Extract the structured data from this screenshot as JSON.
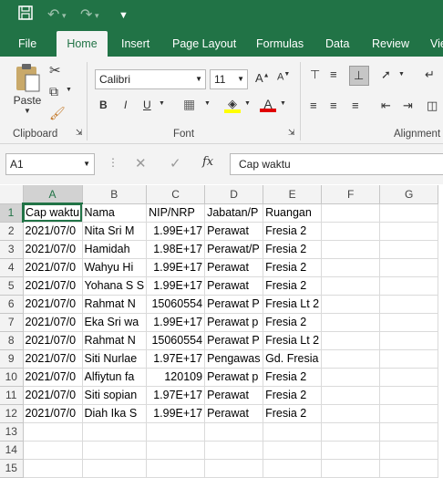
{
  "title_bar": {
    "save": "save-icon",
    "undo": "undo-icon",
    "redo": "redo-icon",
    "customize": "customize-quick-access-icon"
  },
  "tabs": [
    "File",
    "Home",
    "Insert",
    "Page Layout",
    "Formulas",
    "Data",
    "Review",
    "Vie"
  ],
  "active_tab": "Home",
  "clipboard": {
    "paste_label": "Paste",
    "group_label": "Clipboard"
  },
  "font": {
    "name": "Calibri",
    "size": "11",
    "group_label": "Font",
    "bold": "B",
    "italic": "I",
    "underline": "U"
  },
  "alignment": {
    "group_label": "Alignment"
  },
  "name_box": "A1",
  "formula_value": "Cap waktu",
  "fx_label": "fx",
  "columns": [
    "A",
    "B",
    "C",
    "D",
    "E",
    "F",
    "G"
  ],
  "rows": [
    [
      "Cap waktu",
      "Nama",
      "NIP/NRP",
      "Jabatan/P",
      "Ruangan",
      "",
      ""
    ],
    [
      "2021/07/0",
      "Nita Sri M",
      "1.99E+17",
      "Perawat",
      "Fresia 2",
      "",
      ""
    ],
    [
      "2021/07/0",
      "Hamidah",
      "1.98E+17",
      "Perawat/P",
      "Fresia 2",
      "",
      ""
    ],
    [
      "2021/07/0",
      "Wahyu Hi",
      "1.99E+17",
      "Perawat",
      "Fresia 2",
      "",
      ""
    ],
    [
      "2021/07/0",
      "Yohana S S",
      "1.99E+17",
      "Perawat",
      "Fresia 2",
      "",
      ""
    ],
    [
      "2021/07/0",
      "Rahmat N",
      "15060554",
      "Perawat P",
      "Fresia Lt 2",
      "",
      ""
    ],
    [
      "2021/07/0",
      "Eka Sri wa",
      "1.99E+17",
      "Perawat p",
      "Fresia 2",
      "",
      ""
    ],
    [
      "2021/07/0",
      "Rahmat N",
      "15060554",
      "Perawat P",
      "Fresia Lt 2",
      "",
      ""
    ],
    [
      "2021/07/0",
      "Siti Nurlae",
      "1.97E+17",
      "Pengawas",
      "Gd. Fresia",
      "",
      ""
    ],
    [
      "2021/07/0",
      "Alfiytun fa",
      "120109",
      "Perawat p",
      "Fresia 2",
      "",
      ""
    ],
    [
      "2021/07/0",
      "Siti sopian",
      "1.97E+17",
      "Perawat",
      "Fresia 2",
      "",
      ""
    ],
    [
      "2021/07/0",
      "Diah Ika S",
      "1.99E+17",
      "Perawat",
      "Fresia 2",
      "",
      ""
    ],
    [
      "",
      "",
      "",
      "",
      "",
      "",
      ""
    ],
    [
      "",
      "",
      "",
      "",
      "",
      "",
      ""
    ],
    [
      "",
      "",
      "",
      "",
      "",
      "",
      ""
    ]
  ]
}
